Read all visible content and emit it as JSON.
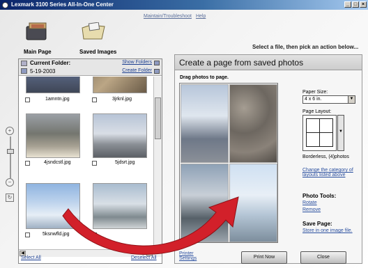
{
  "window": {
    "title": "Lexmark 3100 Series All-In-One Center",
    "buttons": [
      "_",
      "□",
      "×"
    ]
  },
  "toplinks": {
    "maintain": "Maintain/Troubleshoot",
    "help": "Help"
  },
  "tabs": [
    {
      "label": "Main Page",
      "icon": "main-page-icon"
    },
    {
      "label": "Saved Images",
      "icon": "saved-images-icon"
    }
  ],
  "instruction": "Select a file, then pick an action below...",
  "browser": {
    "current_folder_label": "Current Folder:",
    "current_folder_value": "5-19-2003",
    "show_folders": "Show Folders",
    "create_folder": "Create Folder",
    "files": [
      "1amntn.jpg",
      "3jrknl.jpg",
      "4jsndcstl.jpg",
      "5jdsrt.jpg",
      "5ksnwfld.jpg",
      ""
    ],
    "select_all": "Select All",
    "deselect_all": "Deselect All"
  },
  "panel": {
    "title": "Create a page from saved photos",
    "drag_label": "Drag photos to page.",
    "paper_size_label": "Paper Size:",
    "paper_size_value": "4 x 6 in.",
    "page_layout_label": "Page Layout:",
    "layout_caption": "Borderless, (4)photos",
    "change_category_link": "Change the category of layouts listed above",
    "photo_tools_label": "Photo Tools:",
    "rotate": "Rotate",
    "remove": "Remove",
    "save_page_label": "Save Page:",
    "store_link": "Store in one image file.",
    "printer_settings": "Printer Settings",
    "print_now": "Print Now",
    "close": "Close"
  },
  "colors": {
    "title_bar": "#0a246a",
    "arrow": "#d2202a",
    "link": "#1a3d8f"
  }
}
